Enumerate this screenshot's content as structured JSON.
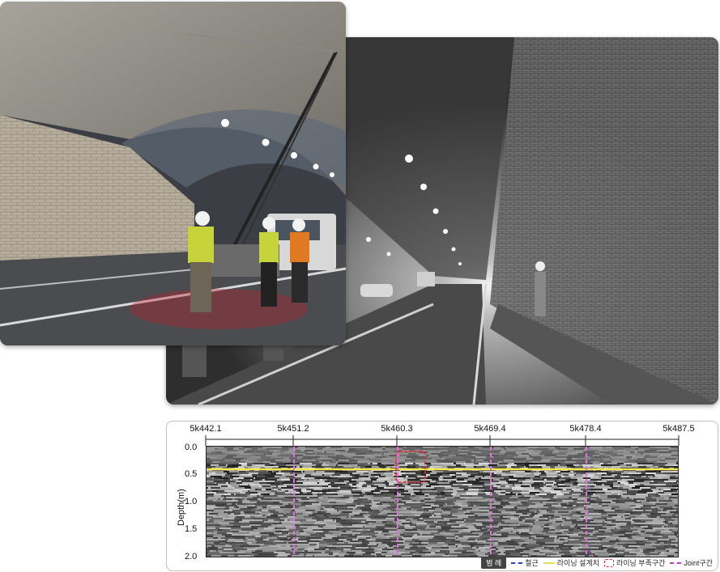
{
  "gpr": {
    "top_axis_labels": [
      "5k442.1",
      "5k451.2",
      "5k460.3",
      "5k469.4",
      "5k478.4",
      "5k487.5"
    ],
    "depth_axis_title": "Depth(m)",
    "depth_labels": [
      "0.0",
      "0.5",
      "1.0",
      "1.5",
      "2.0"
    ],
    "legend": {
      "title": "범 례",
      "items": [
        {
          "label": "철근",
          "color": "#2a3fd0",
          "style": "dash"
        },
        {
          "label": "라이닝 설계치",
          "color": "#e8e04a",
          "style": "solid"
        },
        {
          "label": "라이닝 부족구간",
          "color": "#e8303a",
          "style": "box"
        },
        {
          "label": "Joint구간",
          "color": "#c040c0",
          "style": "dash"
        }
      ]
    },
    "colors": {
      "design_line": "#f0e850",
      "joint_line": "#e070e0",
      "deficit_box": "#e8303a"
    }
  }
}
